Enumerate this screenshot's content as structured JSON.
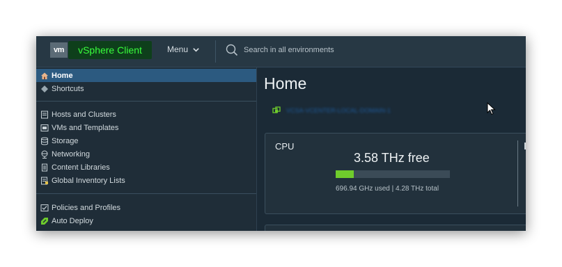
{
  "header": {
    "logo": "vm",
    "app_title": "vSphere Client",
    "menu_label": "Menu",
    "search_placeholder": "Search in all environments"
  },
  "sidebar": {
    "items": [
      {
        "label": "Home",
        "icon": "home-icon",
        "active": true
      },
      {
        "label": "Shortcuts",
        "icon": "shortcuts-icon"
      },
      {
        "label": "Hosts and Clusters",
        "icon": "hosts-icon"
      },
      {
        "label": "VMs and Templates",
        "icon": "vms-icon"
      },
      {
        "label": "Storage",
        "icon": "storage-icon"
      },
      {
        "label": "Networking",
        "icon": "network-icon"
      },
      {
        "label": "Content Libraries",
        "icon": "library-icon"
      },
      {
        "label": "Global Inventory Lists",
        "icon": "inventory-icon"
      },
      {
        "label": "Policies and Profiles",
        "icon": "policies-icon"
      },
      {
        "label": "Auto Deploy",
        "icon": "auto-deploy-icon"
      }
    ]
  },
  "main": {
    "title": "Home",
    "vcenter_name": "VCSA-VCENTER-LOCAL-DOMAIN-1",
    "cpu_card": {
      "title": "CPU",
      "free": "3.58 THz free",
      "meta": "696.94 GHz used | 4.28 THz total",
      "used_fraction": 0.16
    }
  },
  "colors": {
    "accent": "#39ff3c",
    "active_nav": "#2c5a80",
    "progress": "#6fcc2c"
  }
}
